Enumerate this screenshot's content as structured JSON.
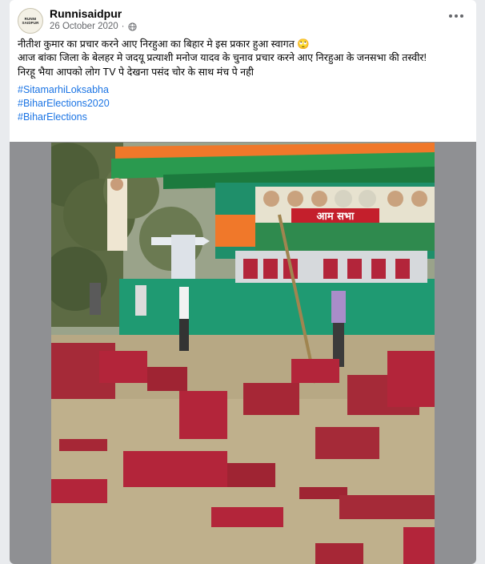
{
  "post": {
    "author": "Runnisaidpur",
    "avatar_text": "RUNNI SAIDPUR",
    "date": "26 October 2020",
    "privacy_icon": "globe-icon",
    "menu_icon": "more-horizontal-icon",
    "text_lines": [
      "नीतीश कुमार का प्रचार करने आए निरहुआ का बिहार मे इस प्रकार हुआ स्वागत 🙄",
      "आज बांका जिला के बेलहर मे जदयू प्रत्याशी मनोज यादव के चुनाव प्रचार करने आए निरहुआ के जनसभा की तस्वीर!",
      "निरहू भैया आपको लोग TV पे देखना पसंद चोर के साथ मंच पे नही"
    ],
    "hashtags": [
      "#SitamarhiLoksabha",
      "#BiharElections2020",
      "#BiharElections"
    ]
  },
  "photo": {
    "description_icon": "rally-photo",
    "banner_text": "आम सभा",
    "colors": {
      "stage_green": "#1f8f6a",
      "roof_green": "#2a9a4f",
      "saffron": "#f0782a",
      "chair_red": "#b3253a",
      "ground": "#b7a884",
      "link_blue": "#1b74e4"
    }
  }
}
